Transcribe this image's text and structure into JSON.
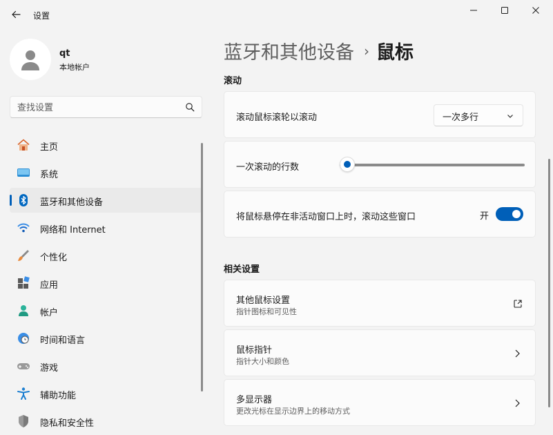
{
  "window": {
    "title": "设置",
    "accent_color": "#005fb8"
  },
  "user": {
    "name": "qt",
    "account_type": "本地帐户"
  },
  "search": {
    "placeholder": "查找设置"
  },
  "sidebar": {
    "items": [
      {
        "label": "主页",
        "icon": "home-icon",
        "active": false
      },
      {
        "label": "系统",
        "icon": "system-icon",
        "active": false
      },
      {
        "label": "蓝牙和其他设备",
        "icon": "bluetooth-icon",
        "active": true
      },
      {
        "label": "网络和 Internet",
        "icon": "wifi-icon",
        "active": false
      },
      {
        "label": "个性化",
        "icon": "brush-icon",
        "active": false
      },
      {
        "label": "应用",
        "icon": "apps-icon",
        "active": false
      },
      {
        "label": "帐户",
        "icon": "account-icon",
        "active": false
      },
      {
        "label": "时间和语言",
        "icon": "globe-clock-icon",
        "active": false
      },
      {
        "label": "游戏",
        "icon": "gamepad-icon",
        "active": false
      },
      {
        "label": "辅助功能",
        "icon": "accessibility-icon",
        "active": false
      },
      {
        "label": "隐私和安全性",
        "icon": "shield-icon",
        "active": false
      }
    ]
  },
  "breadcrumb": {
    "parent": "蓝牙和其他设备",
    "current": "鼠标"
  },
  "scroll_section": {
    "header": "滚动",
    "wheel_label": "滚动鼠标滚轮以滚动",
    "wheel_value": "一次多行",
    "lines_label": "一次滚动的行数",
    "lines_fraction": 0.04,
    "inactive_label": "将鼠标悬停在非活动窗口上时，滚动这些窗口",
    "inactive_state": "开",
    "inactive_on": true
  },
  "related_section": {
    "header": "相关设置",
    "items": [
      {
        "title": "其他鼠标设置",
        "subtitle": "指针图标和可见性",
        "icon": "external-link-icon"
      },
      {
        "title": "鼠标指针",
        "subtitle": "指针大小和颜色",
        "icon": "chevron-right-icon"
      },
      {
        "title": "多显示器",
        "subtitle": "更改光标在显示边界上的移动方式",
        "icon": "chevron-right-icon"
      }
    ]
  }
}
